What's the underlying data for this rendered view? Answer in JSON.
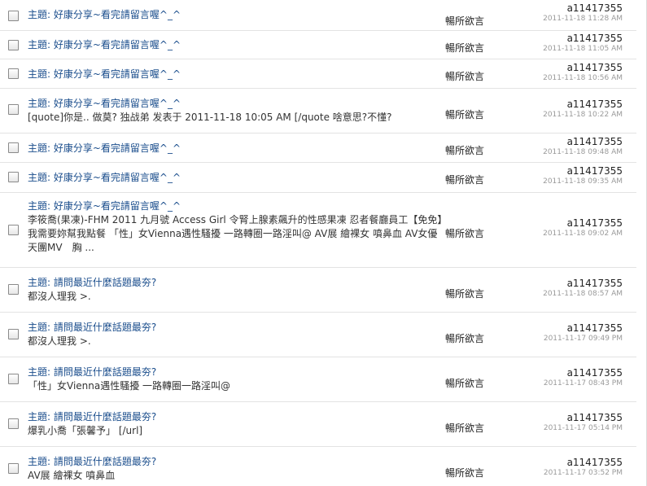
{
  "rows": [
    {
      "subject": "主題: 好康分享~看完請留言喔^_^",
      "snippet": "",
      "folder": "暢所欲言",
      "author": "a11417355",
      "date": "2011-11-18 11:28 AM"
    },
    {
      "subject": "主題: 好康分享~看完請留言喔^_^",
      "snippet": "",
      "folder": "暢所欲言",
      "author": "a11417355",
      "date": "2011-11-18 11:05 AM"
    },
    {
      "subject": "主題: 好康分享~看完請留言喔^_^",
      "snippet": "",
      "folder": "暢所欲言",
      "author": "a11417355",
      "date": "2011-11-18 10:56 AM"
    },
    {
      "subject": "主題: 好康分享~看完請留言喔^_^",
      "snippet": "[quote]你是.. 做莫? 独战弟 发表于 2011-11-18 10:05 AM [/quote 啥意思?不懂?",
      "folder": "暢所欲言",
      "author": "a11417355",
      "date": "2011-11-18 10:22 AM"
    },
    {
      "subject": "主題: 好康分享~看完請留言喔^_^",
      "snippet": "",
      "folder": "暢所欲言",
      "author": "a11417355",
      "date": "2011-11-18 09:48 AM"
    },
    {
      "subject": "主題: 好康分享~看完請留言喔^_^",
      "snippet": "",
      "folder": "暢所欲言",
      "author": "a11417355",
      "date": "2011-11-18 09:35 AM"
    },
    {
      "subject": "主題: 好康分享~看完請留言喔^_^",
      "snippet": "李筱喬(果凍)-FHM 2011 九月號 Access Girl 令腎上腺素飆升的性感果凍 忍者餐廳員工【免免】我需要妳幫我點餐 「性」女Vienna遇性騷擾 一路轉圈一路淫叫@ AV展 繪裸女 噴鼻血 AV女優天團MV　胸 ...",
      "folder": "暢所欲言",
      "author": "a11417355",
      "date": "2011-11-18 09:02 AM"
    },
    {
      "subject": "主題: 請問最近什麼話題最夯?",
      "snippet": "都沒人理我 >.",
      "folder": "暢所欲言",
      "author": "a11417355",
      "date": "2011-11-18 08:57 AM"
    },
    {
      "subject": "主題: 請問最近什麼話題最夯?",
      "snippet": "都沒人理我 >.",
      "folder": "暢所欲言",
      "author": "a11417355",
      "date": "2011-11-17 09:49 PM"
    },
    {
      "subject": "主題: 請問最近什麼話題最夯?",
      "snippet": "「性」女Vienna遇性騷擾 一路轉圈一路淫叫@",
      "folder": "暢所欲言",
      "author": "a11417355",
      "date": "2011-11-17 08:43 PM"
    },
    {
      "subject": "主題: 請問最近什麼話題最夯?",
      "snippet": "爆乳小喬「張馨予」 [/url]",
      "folder": "暢所欲言",
      "author": "a11417355",
      "date": "2011-11-17 05:14 PM"
    },
    {
      "subject": "主題: 請問最近什麼話題最夯?",
      "snippet": "AV展 繪裸女 噴鼻血",
      "folder": "暢所欲言",
      "author": "a11417355",
      "date": "2011-11-17 03:52 PM"
    }
  ]
}
